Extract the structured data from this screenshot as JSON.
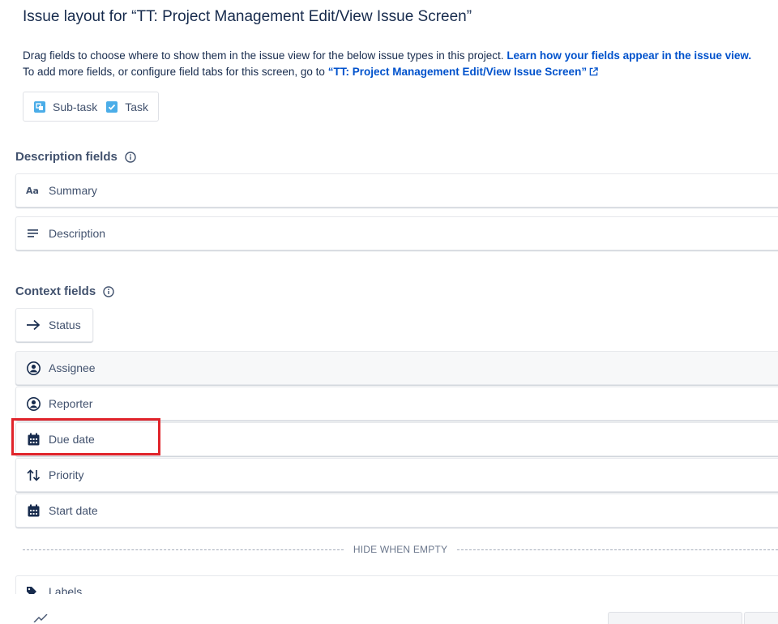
{
  "page": {
    "title": "Issue layout for “TT: Project Management Edit/View Issue Screen”",
    "intro_line1": "Drag fields to choose where to show them in the issue view for the below issue types in this project.",
    "intro_link1": "Learn how your fields appear in the issue view.",
    "intro_line2": "To add more fields, or configure field tabs for this screen, go to",
    "intro_link2": "“TT: Project Management Edit/View Issue Screen”"
  },
  "issue_types": [
    {
      "label": "Sub-task",
      "icon": "subtask-icon"
    },
    {
      "label": "Task",
      "icon": "task-checkbox-icon"
    }
  ],
  "description_section": {
    "title": "Description fields",
    "fields": [
      {
        "label": "Summary",
        "icon": "text-icon"
      },
      {
        "label": "Description",
        "icon": "paragraph-icon"
      }
    ]
  },
  "context_section": {
    "title": "Context fields",
    "status": {
      "label": "Status",
      "icon": "arrow-right-icon"
    },
    "fields": [
      {
        "label": "Assignee",
        "icon": "person-icon"
      },
      {
        "label": "Reporter",
        "icon": "person-icon"
      },
      {
        "label": "Due date",
        "icon": "calendar-icon"
      },
      {
        "label": "Priority",
        "icon": "sort-arrows-icon"
      },
      {
        "label": "Start date",
        "icon": "calendar-icon"
      }
    ],
    "hide_when_empty_label": "HIDE WHEN EMPTY",
    "hidden_fields": [
      {
        "label": "Labels",
        "icon": "tag-icon"
      }
    ]
  },
  "colors": {
    "link": "#0052cc",
    "highlight": "#e0242b",
    "text": "#172b4d",
    "subtle_text": "#42526e"
  }
}
